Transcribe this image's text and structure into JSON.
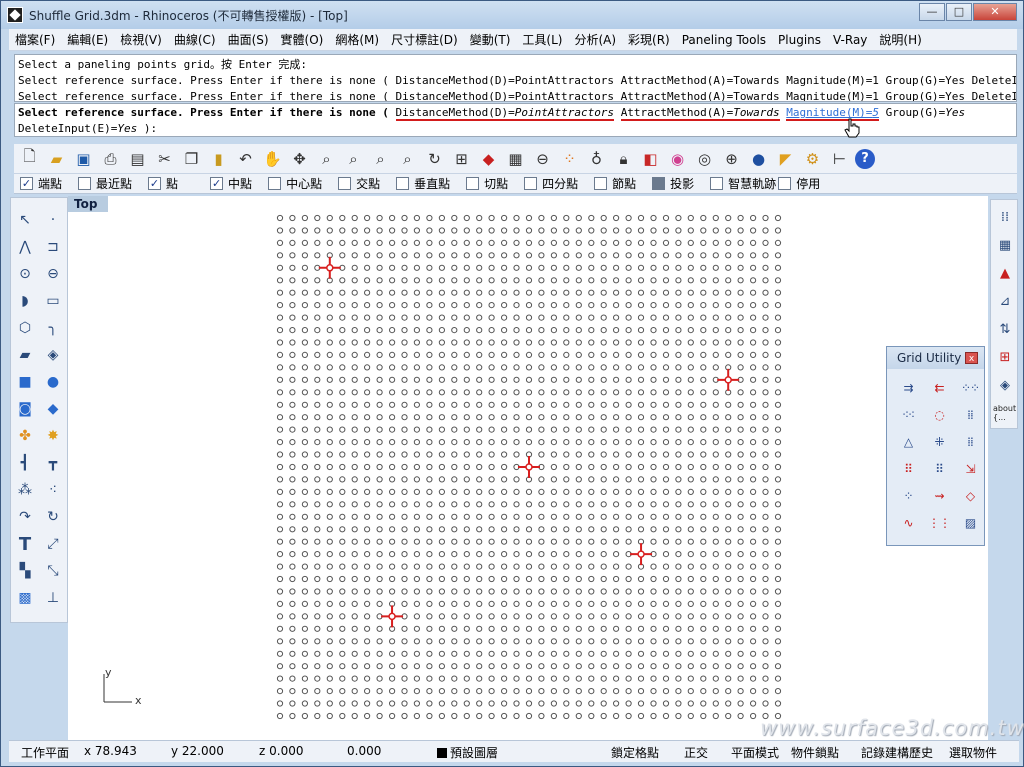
{
  "window": {
    "title": "Shuffle Grid.3dm - Rhinoceros (不可轉售授權版) - [Top]",
    "controls": {
      "minimize": "—",
      "maximize": "□",
      "close": "✕"
    }
  },
  "menubar": [
    "檔案(F)",
    "編輯(E)",
    "檢視(V)",
    "曲線(C)",
    "曲面(S)",
    "實體(O)",
    "網格(M)",
    "尺寸標註(D)",
    "變動(T)",
    "工具(L)",
    "分析(A)",
    "彩現(R)",
    "Paneling Tools",
    "Plugins",
    "V-Ray",
    "說明(H)"
  ],
  "command_history": [
    "Select a paneling points grid。按 Enter 完成:",
    "Select reference surface. Press Enter if there is none ( DistanceMethod(D)=PointAttractors  AttractMethod(A)=Towards  Magnitude(M)=1  Group(G)=Yes  DeleteInput(E)=Y",
    "Select reference surface. Press Enter if there is none ( DistanceMethod(D)=PointAttractors  AttractMethod(A)=Towards  Magnitude(M)=1  Group(G)=Yes  DeleteInput(E)="
  ],
  "command_prompt": {
    "text": "Select reference surface. Press Enter if there is none (",
    "options": [
      {
        "name": "DistanceMethod(D)=",
        "value": "PointAttractors"
      },
      {
        "name": "AttractMethod(A)=",
        "value": "Towards"
      },
      {
        "name": "Magnitude(M)=",
        "value": "5"
      },
      {
        "name": "Group(G)=",
        "value": "Yes"
      },
      {
        "name": "DeleteInput(E)=",
        "value": "Yes"
      }
    ],
    "end": " ):"
  },
  "main_toolbar_icons": [
    "new-file-icon",
    "open-folder-icon",
    "save-icon",
    "print-icon",
    "import-icon",
    "cut-icon",
    "copy-icon",
    "paste-icon",
    "undo-icon",
    "pan-hand-icon",
    "rotate-view-icon",
    "zoom-icon",
    "zoom-window-icon",
    "zoom-extents-icon",
    "zoom-selected-icon",
    "redo-view-icon",
    "four-viewports-icon",
    "car-icon",
    "grid-plane-icon",
    "snap-icon",
    "grip-icon",
    "light-bulb-icon",
    "lock-icon",
    "layer-icon",
    "color-wheel-icon",
    "shaded-sphere-icon",
    "wireframe-sphere-icon",
    "render-sphere-icon",
    "flag-icon",
    "gear-icon",
    "tree-icon",
    "help-icon"
  ],
  "osnaps": [
    {
      "label": "端點",
      "checked": true
    },
    {
      "label": "最近點",
      "checked": false
    },
    {
      "label": "點",
      "checked": true
    },
    {
      "label": "中點",
      "checked": true
    },
    {
      "label": "中心點",
      "checked": false
    },
    {
      "label": "交點",
      "checked": false
    },
    {
      "label": "垂直點",
      "checked": false
    },
    {
      "label": "切點",
      "checked": false
    },
    {
      "label": "四分點",
      "checked": false
    },
    {
      "label": "節點",
      "checked": false
    },
    {
      "label": "投影",
      "checked": "filled"
    },
    {
      "label": "智慧軌跡",
      "checked": false
    },
    {
      "label": "停用",
      "checked": false
    }
  ],
  "viewport": {
    "tab": "Top",
    "axis_y": "y",
    "axis_x": "x",
    "grid_cols": 41,
    "grid_rows": 41,
    "attractors": [
      [
        4,
        4
      ],
      [
        36,
        13
      ],
      [
        20,
        20
      ],
      [
        29,
        27
      ],
      [
        9,
        32
      ]
    ]
  },
  "grid_utility": {
    "title": "Grid Utility",
    "close": "x"
  },
  "right_toolbar_about": "about\n{...",
  "watermark": "www.surface3d.com.tw",
  "statusbar": {
    "cplane": "工作平面",
    "x": "x 78.943",
    "y": "y 22.000",
    "z": "z 0.000",
    "extra": "0.000",
    "layer": "預設圖層",
    "snap": "鎖定格點",
    "ortho": "正交",
    "planar": "平面模式",
    "osnap": "物件鎖點",
    "history": "記錄建構歷史",
    "filter": "選取物件"
  },
  "colors": {
    "attractor": "#d81f1f",
    "grid_point": "#555555",
    "link": "#2f6fd6",
    "underline": "#d31b1b"
  }
}
